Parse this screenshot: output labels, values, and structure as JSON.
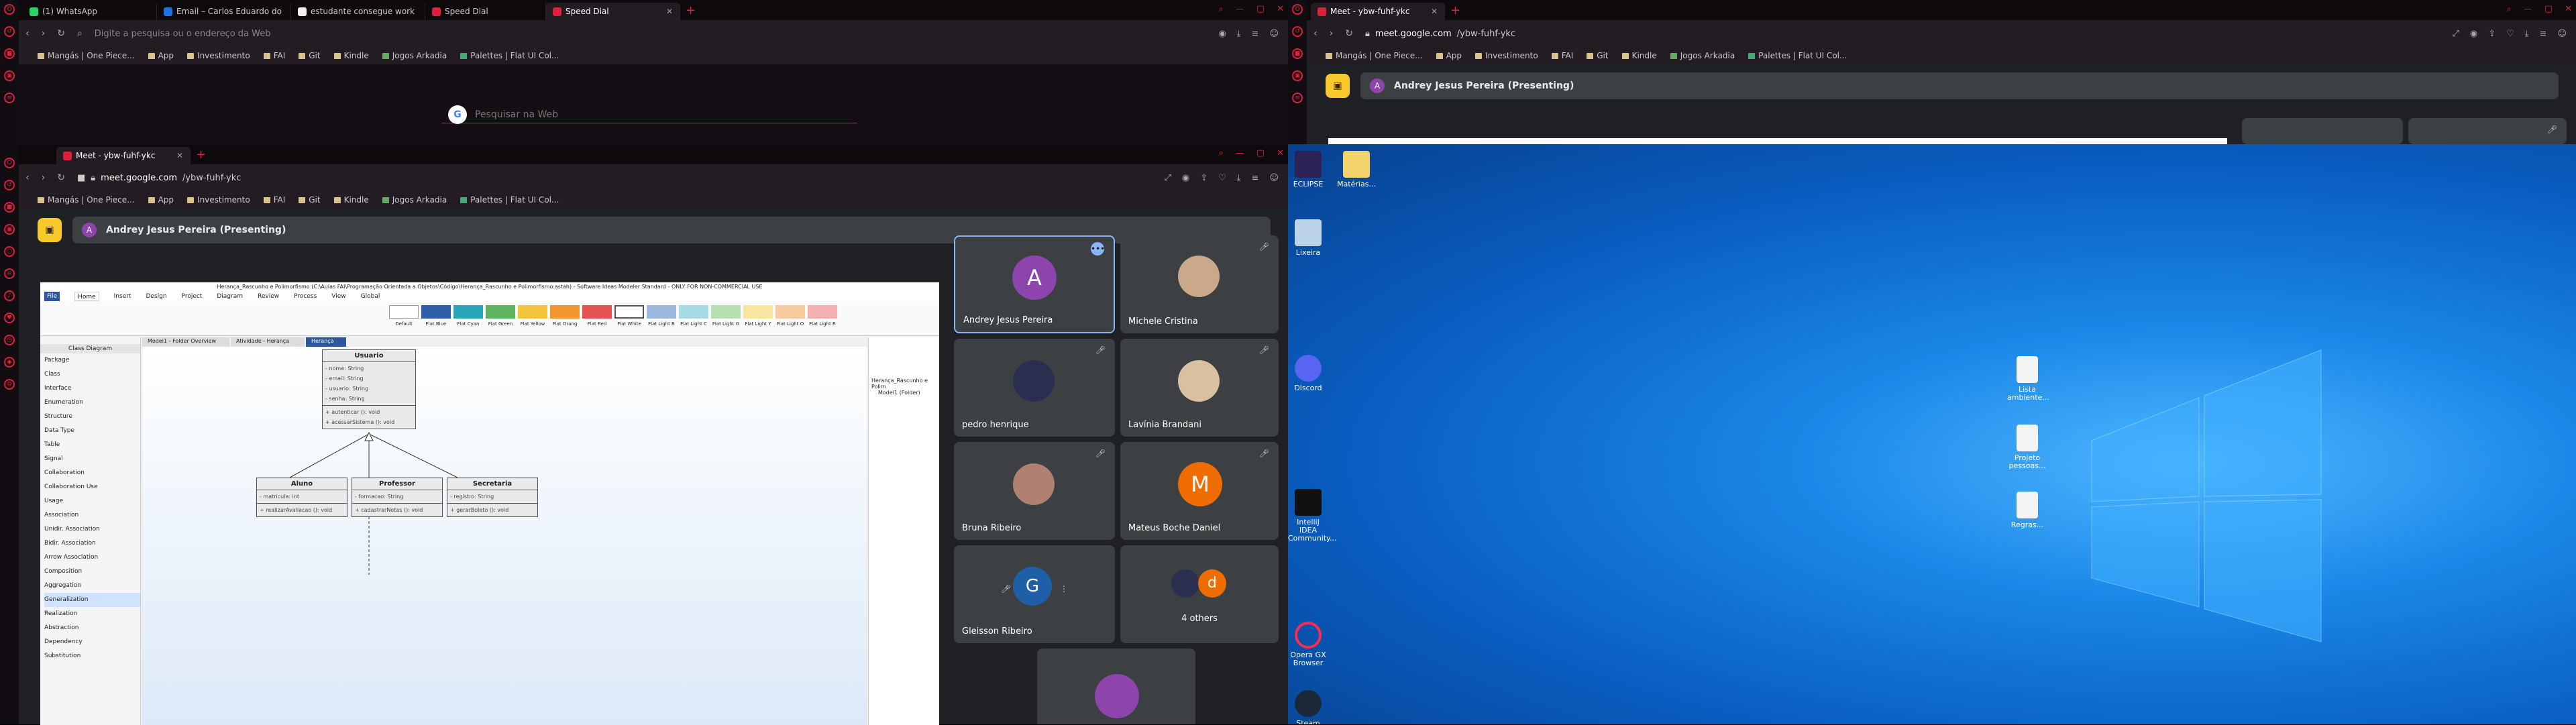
{
  "left_top_browser": {
    "tabs": [
      {
        "label": "(1) WhatsApp",
        "color": "#25d366"
      },
      {
        "label": "Email – Carlos Eduardo do",
        "color": "#1a73e8"
      },
      {
        "label": "estudante consegue work",
        "color": "#ddd"
      },
      {
        "label": "Speed Dial",
        "color": "#e0203a"
      },
      {
        "label": "Speed Dial",
        "color": "#e0203a"
      }
    ],
    "address_placeholder": "Digite a pesquisa ou o endereço da Web",
    "search_placeholder": "Pesquisar na Web"
  },
  "bookmarks": [
    {
      "label": "Mangás | One Piece..."
    },
    {
      "label": "App"
    },
    {
      "label": "Investimento"
    },
    {
      "label": "FAI"
    },
    {
      "label": "Git"
    },
    {
      "label": "Kindle"
    },
    {
      "label": "Jogos Arkadia"
    },
    {
      "label": "Palettes | Flat UI Col..."
    }
  ],
  "meet_tab_label": "Meet - ybw-fuhf-ykc",
  "meet_url_host": "meet.google.com",
  "meet_url_path": "/ybw-fuhf-ykc",
  "presenting_initial": "A",
  "presenting_label": "Andrey Jesus Pereira (Presenting)",
  "participants": [
    {
      "name": "Andrey Jesus Pereira",
      "initial": "A",
      "color": "#8e44ad"
    },
    {
      "name": "Michele Cristina",
      "initial": "",
      "color": "#c9a98a"
    },
    {
      "name": "pedro henrique",
      "initial": "",
      "color": "#2a2f50"
    },
    {
      "name": "Lavínia Brandani",
      "initial": "",
      "color": "#d8c0a0"
    },
    {
      "name": "Bruna Ribeiro",
      "initial": "",
      "color": "#b08070"
    },
    {
      "name": "Mateus Boche Daniel",
      "initial": "M",
      "color": "#ef6c00"
    },
    {
      "name": "Gleisson Ribeiro",
      "initial": "G",
      "color": "#1e5fa8"
    },
    {
      "name": "4 others",
      "initial": "d",
      "color": "#ef6c00"
    }
  ],
  "astah": {
    "title": "Herança_Rascunho e Polimorfismo (C:\\Aulas FAI\\Programação Orientada a Objetos\\Código\\Herança_Rascunho e Polimorfismo.astah) - Software Ideas Modeler Standard - ONLY FOR NON-COMMERCIAL USE",
    "menu": [
      "File",
      "Home",
      "Insert",
      "Design",
      "Project",
      "Diagram",
      "Review",
      "Process",
      "View",
      "Global"
    ],
    "doc_tabs": [
      "Model1 - Folder Overview",
      "Atividade - Herança",
      "Herança"
    ],
    "palette_title": "Class Diagram",
    "palette": [
      "Package",
      "Class",
      "Interface",
      "Enumeration",
      "Structure",
      "Data Type",
      "Table",
      "Signal",
      "Collaboration",
      "Collaboration Use",
      "Usage",
      "Association",
      "Unidir. Association",
      "Bidir. Association",
      "Arrow Association",
      "Composition",
      "Aggregation",
      "Generalization",
      "Realization",
      "Abstraction",
      "Dependency",
      "Substitution"
    ],
    "styles": [
      "Default",
      "Flat Blue",
      "Flat Cyan",
      "Flat Green",
      "Flat Yellow",
      "Flat Orang",
      "Flat Red",
      "Flat White",
      "Flat Light B",
      "Flat Light C",
      "Flat Light G",
      "Flat Light Y",
      "Flat Light O",
      "Flat Light R"
    ],
    "project_items": [
      "Herança_Rascunho e Polim",
      "Model1 (Folder)"
    ],
    "classes": {
      "usuario": {
        "name": "Usuario",
        "attrs": [
          "- nome: String",
          "- email: String",
          "- usuario: String",
          "- senha: String"
        ],
        "ops": [
          "+ autenticar (): void",
          "+ acessarSistema (): void"
        ]
      },
      "aluno": {
        "name": "Aluno",
        "attrs": [
          "- matricula: int"
        ],
        "ops": [
          "+ realizarAvaliacao (): void"
        ]
      },
      "professor": {
        "name": "Professor",
        "attrs": [
          "- formacao: String"
        ],
        "ops": [
          "+ cadastrarNotas (): void"
        ]
      },
      "secretaria": {
        "name": "Secretaria",
        "attrs": [
          "- registro: String"
        ],
        "ops": [
          "+ gerarBoleto (): void"
        ]
      }
    }
  },
  "desktop_icons": [
    {
      "label": "ECLIPSE"
    },
    {
      "label": "Matérias..."
    },
    {
      "label": "Lixeira"
    },
    {
      "label": "Discord"
    },
    {
      "label": "IntelliJ IDEA Community..."
    },
    {
      "label": "Opera GX Browser"
    },
    {
      "label": "Steam"
    },
    {
      "label": "Lista ambiente..."
    },
    {
      "label": "Projeto pessoas..."
    },
    {
      "label": "Regras..."
    }
  ]
}
